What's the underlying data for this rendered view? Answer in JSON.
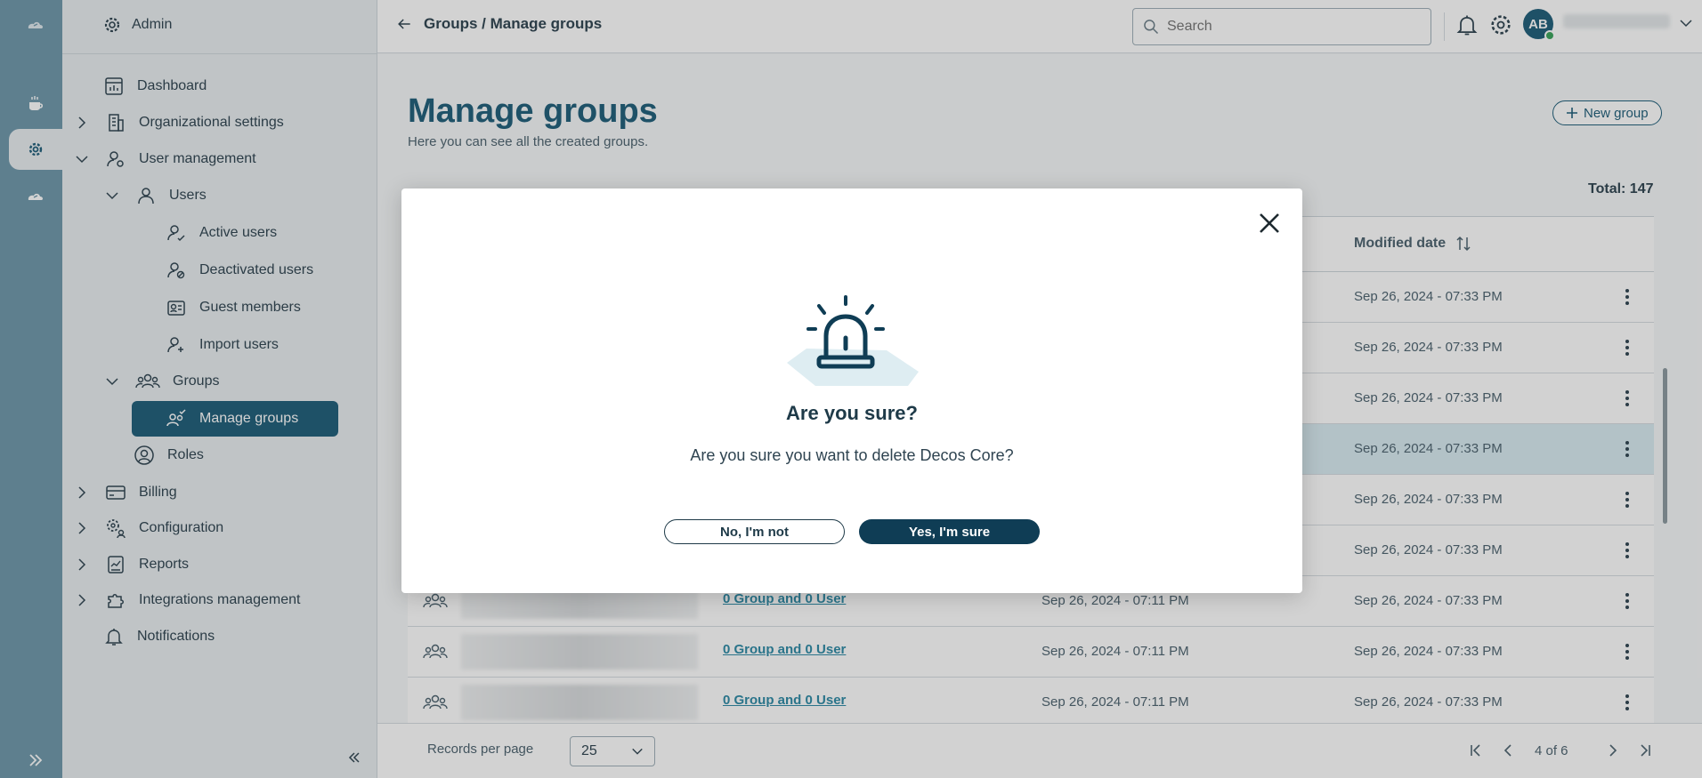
{
  "sidebar": {
    "header": "Admin",
    "items": [
      {
        "label": "Dashboard"
      },
      {
        "label": "Organizational settings"
      },
      {
        "label": "User management"
      },
      {
        "label": "Users"
      },
      {
        "label": "Active users"
      },
      {
        "label": "Deactivated users"
      },
      {
        "label": "Guest members"
      },
      {
        "label": "Import users"
      },
      {
        "label": "Groups"
      },
      {
        "label": "Manage groups"
      },
      {
        "label": "Roles"
      },
      {
        "label": "Billing"
      },
      {
        "label": "Configuration"
      },
      {
        "label": "Reports"
      },
      {
        "label": "Integrations management"
      },
      {
        "label": "Notifications"
      }
    ]
  },
  "topbar": {
    "breadcrumb": "Groups / Manage groups",
    "search_placeholder": "Search",
    "avatar_initials": "AB"
  },
  "main": {
    "title": "Manage groups",
    "subtitle": "Here you can see all the created groups.",
    "new_group_label": "New group",
    "total": "Total: 147",
    "columns": {
      "modified": "Modified date"
    },
    "rows": [
      {
        "modified": "Sep 26, 2024 - 07:33 PM"
      },
      {
        "modified": "Sep 26, 2024 - 07:33 PM"
      },
      {
        "modified": "Sep 26, 2024 - 07:33 PM"
      },
      {
        "modified": "Sep 26, 2024 - 07:33 PM"
      },
      {
        "modified": "Sep 26, 2024 - 07:33 PM"
      },
      {
        "modified": "Sep 26, 2024 - 07:33 PM"
      },
      {
        "members": "0 Group and 0 User",
        "created": "Sep 26, 2024 - 07:11 PM",
        "modified": "Sep 26, 2024 - 07:33 PM"
      },
      {
        "members": "0 Group and 0 User",
        "created": "Sep 26, 2024 - 07:11 PM",
        "modified": "Sep 26, 2024 - 07:33 PM"
      },
      {
        "members": "0 Group and 0 User",
        "created": "Sep 26, 2024 - 07:11 PM",
        "modified": "Sep 26, 2024 - 07:33 PM"
      }
    ],
    "footer": {
      "records_label": "Records per page",
      "records_value": "25",
      "page_info": "4 of 6"
    }
  },
  "modal": {
    "title": "Are you sure?",
    "message": "Are you sure you want to delete Decos Core?",
    "no_label": "No, I'm not",
    "yes_label": "Yes, I'm sure"
  },
  "colors": {
    "primary": "#1f5e7a",
    "dark": "#0f3d55",
    "highlight_row": "#d9ebf2",
    "link": "#2d8aa6"
  }
}
